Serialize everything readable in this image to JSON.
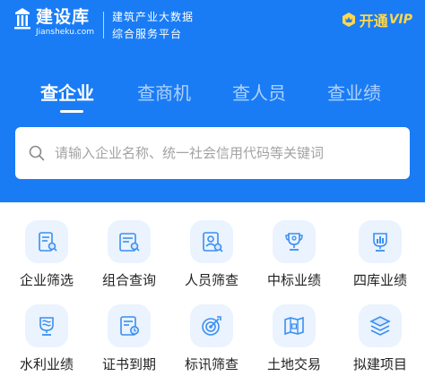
{
  "brand": {
    "name": "建设库",
    "domain": "Jiansheku.com",
    "slogan_line1": "建筑产业大数据",
    "slogan_line2": "综合服务平台"
  },
  "vip": {
    "label": "开通",
    "tag": "VIP"
  },
  "tabs": [
    {
      "label": "查企业",
      "active": true
    },
    {
      "label": "查商机",
      "active": false
    },
    {
      "label": "查人员",
      "active": false
    },
    {
      "label": "查业绩",
      "active": false
    }
  ],
  "search": {
    "placeholder": "请输入企业名称、统一社会信用代码等关键词"
  },
  "grid": [
    {
      "label": "企业筛选",
      "icon": "company-filter-icon"
    },
    {
      "label": "组合查询",
      "icon": "combined-query-icon"
    },
    {
      "label": "人员筛查",
      "icon": "personnel-screening-icon"
    },
    {
      "label": "中标业绩",
      "icon": "bid-winning-trophy-icon"
    },
    {
      "label": "四库业绩",
      "icon": "four-library-chart-icon"
    },
    {
      "label": "水利业绩",
      "icon": "water-conservancy-icon"
    },
    {
      "label": "证书到期",
      "icon": "certificate-expiry-icon"
    },
    {
      "label": "标讯筛查",
      "icon": "tender-target-icon"
    },
    {
      "label": "土地交易",
      "icon": "land-trade-icon"
    },
    {
      "label": "拟建项目",
      "icon": "planned-project-icon"
    }
  ],
  "colors": {
    "header_bg": "#1a7cf5",
    "vip_gold": "#ffd84d",
    "icon_tile_bg": "#eaf3fe",
    "icon_stroke": "#3b8ff0",
    "text_dark": "#222222"
  }
}
